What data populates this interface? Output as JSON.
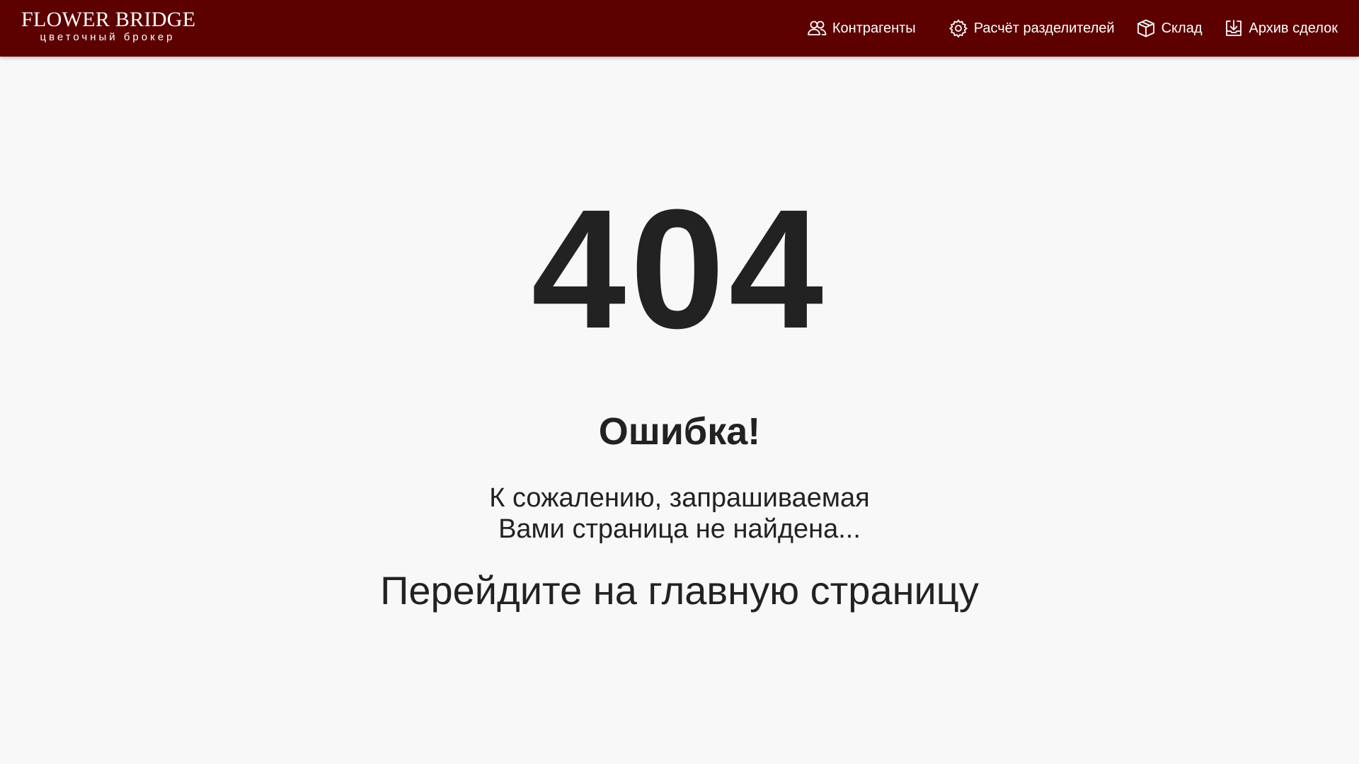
{
  "header": {
    "background": "#5c0000",
    "logo": {
      "title": "FLOWER BRIDGE",
      "subtitle": "цветочный брокер"
    },
    "nav": [
      {
        "label": "Контрагенты",
        "icon": "users-icon"
      },
      {
        "label": "Расчёт разделителей",
        "icon": "gear-icon"
      },
      {
        "label": "Склад",
        "icon": "box-icon"
      },
      {
        "label": "Архив сделок",
        "icon": "archive-download-icon"
      }
    ]
  },
  "main": {
    "code": "404",
    "title": "Ошибка!",
    "message_line1": "К сожалению, запрашиваемая",
    "message_line2": "Вами страница не найдена...",
    "home_link": "Перейдите на главную страницу"
  }
}
